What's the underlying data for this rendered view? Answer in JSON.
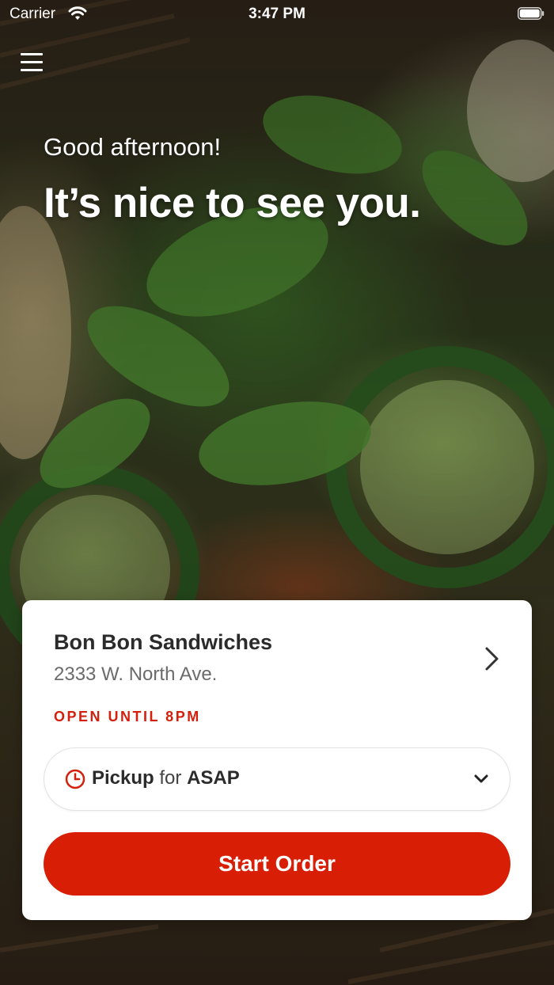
{
  "status_bar": {
    "carrier": "Carrier",
    "time": "3:47 PM"
  },
  "icons": {
    "menu": "hamburger-menu-icon",
    "wifi": "wifi-icon",
    "battery": "battery-icon",
    "chevron_right": "chevron-right-icon",
    "clock": "clock-icon",
    "chevron_down": "chevron-down-icon"
  },
  "greeting": {
    "subtitle": "Good afternoon!",
    "headline": "It’s nice to see you."
  },
  "store": {
    "name": "Bon Bon Sandwiches",
    "address": "2333 W. North Ave.",
    "hours": "OPEN UNTIL 8PM"
  },
  "order_mode": {
    "method": "Pickup",
    "connector": "for",
    "time": "ASAP"
  },
  "cta": {
    "label": "Start Order"
  },
  "colors": {
    "accent": "#d91e06",
    "hours_text": "#d3200d"
  }
}
